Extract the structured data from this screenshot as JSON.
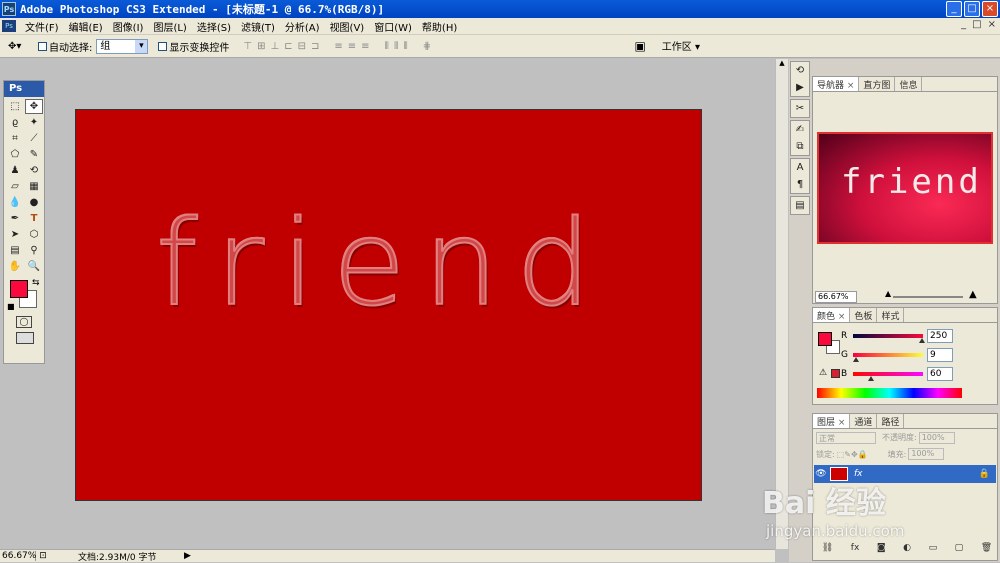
{
  "window": {
    "app_icon": "Ps",
    "title": "Adobe Photoshop CS3 Extended - [未标题-1 @ 66.7%(RGB/8)]",
    "buttons": [
      "_",
      "□",
      "×"
    ]
  },
  "menu": {
    "items": [
      "文件(F)",
      "编辑(E)",
      "图像(I)",
      "图层(L)",
      "选择(S)",
      "滤镜(T)",
      "分析(A)",
      "视图(V)",
      "窗口(W)",
      "帮助(H)"
    ],
    "doc_buttons": [
      "_",
      "□",
      "×"
    ]
  },
  "options": {
    "auto_select_label": "自动选择:",
    "auto_select_value": "组",
    "show_transform_label": "显示变换控件",
    "workspace_label": "工作区 ▾"
  },
  "toolbox": {
    "header": "Ps",
    "fg_color": "#fa093c",
    "bg_color": "#ffffff"
  },
  "canvas": {
    "text": "friend",
    "background": "#c00000"
  },
  "status": {
    "zoom": "66.67%",
    "doc_info": "文档:2.93M/0 字节"
  },
  "navigator": {
    "tabs": [
      "导航器",
      "直方图",
      "信息"
    ],
    "preview_text": "friend",
    "zoom": "66.67%"
  },
  "color_panel": {
    "tabs": [
      "颜色",
      "色板",
      "样式"
    ],
    "r_label": "R",
    "r_value": "250",
    "g_label": "G",
    "g_value": "9",
    "b_label": "B",
    "b_value": "60"
  },
  "layers_panel": {
    "tabs": [
      "图层",
      "通道",
      "路径"
    ],
    "blend_mode": "正常",
    "opacity_label": "不透明度:",
    "opacity_value": "100%",
    "lock_label": "锁定:",
    "fill_label": "填充:",
    "fill_value": "100%"
  },
  "watermark": {
    "logo": "Bai 经验",
    "url": "jingyan.baidu.com"
  }
}
